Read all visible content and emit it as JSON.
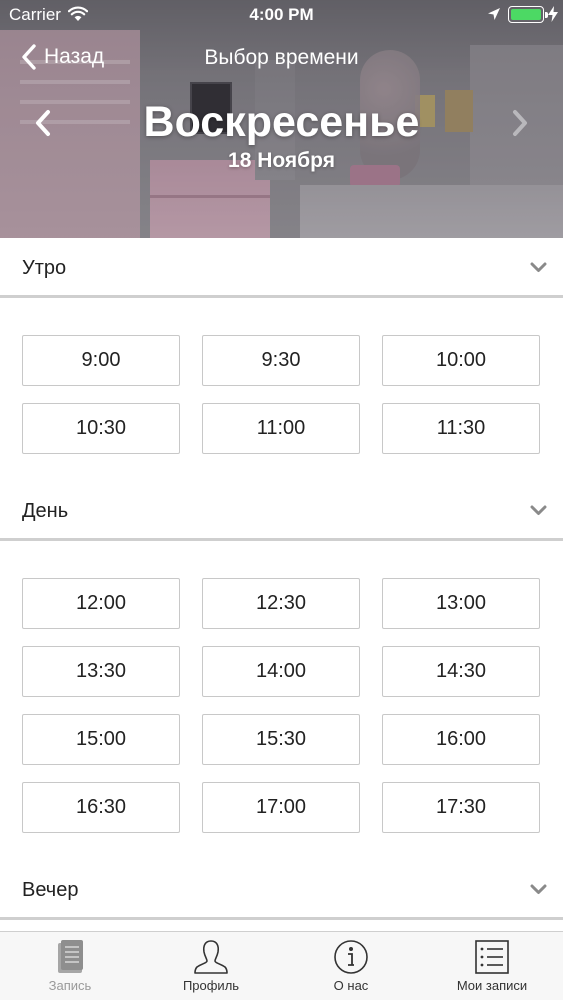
{
  "status_bar": {
    "carrier": "Carrier",
    "time": "4:00 PM"
  },
  "nav": {
    "back_label": "Назад",
    "title": "Выбор времени"
  },
  "day": {
    "name": "Воскресенье",
    "date": "18 Ноября"
  },
  "sections": [
    {
      "title": "Утро",
      "slots": [
        "9:00",
        "9:30",
        "10:00",
        "10:30",
        "11:00",
        "11:30"
      ]
    },
    {
      "title": "День",
      "slots": [
        "12:00",
        "12:30",
        "13:00",
        "13:30",
        "14:00",
        "14:30",
        "15:00",
        "15:30",
        "16:00",
        "16:30",
        "17:00",
        "17:30"
      ]
    },
    {
      "title": "Вечер",
      "slots": []
    }
  ],
  "tab_bar": {
    "tabs": [
      {
        "label": "Запись",
        "icon": "document-icon",
        "active": false
      },
      {
        "label": "Профиль",
        "icon": "profile-icon",
        "active": true
      },
      {
        "label": "О нас",
        "icon": "info-icon",
        "active": true
      },
      {
        "label": "Мои записи",
        "icon": "list-icon",
        "active": true
      }
    ]
  },
  "colors": {
    "battery": "#4cd964",
    "divider": "#cfcfcf",
    "slot_border": "#c8c8c8",
    "tab_inactive": "#9a9a9a"
  }
}
